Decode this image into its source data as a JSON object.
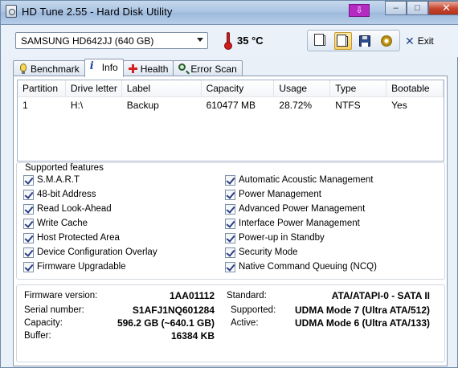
{
  "window": {
    "title": "HD Tune 2.55 - Hard Disk Utility",
    "badge": "⇩",
    "min": "–",
    "max": "□",
    "close": "✕"
  },
  "toolbar": {
    "drive": "SAMSUNG HD642JJ (640 GB)",
    "temperature": "35 °C",
    "exit": "Exit",
    "tools": [
      "copy-text-icon",
      "copy-screenshot-icon",
      "save-icon",
      "options-icon"
    ]
  },
  "tabs": [
    {
      "label": "Benchmark",
      "icon": "bulb-icon"
    },
    {
      "label": "Info",
      "icon": "info-icon",
      "active": true
    },
    {
      "label": "Health",
      "icon": "health-cross-icon"
    },
    {
      "label": "Error Scan",
      "icon": "magnifier-icon"
    }
  ],
  "partitions": {
    "headers": [
      "Partition",
      "Drive letter",
      "Label",
      "Capacity",
      "Usage",
      "Type",
      "Bootable"
    ],
    "rows": [
      [
        "1",
        "H:\\",
        "Backup",
        "610477 MB",
        "28.72%",
        "NTFS",
        "Yes"
      ]
    ]
  },
  "features": {
    "title": "Supported features",
    "left": [
      "S.M.A.R.T",
      "48-bit Address",
      "Read Look-Ahead",
      "Write Cache",
      "Host Protected Area",
      "Device Configuration Overlay",
      "Firmware Upgradable"
    ],
    "right": [
      "Automatic Acoustic Management",
      "Power Management",
      "Advanced Power Management",
      "Interface Power Management",
      "Power-up in Standby",
      "Security Mode",
      "Native Command Queuing (NCQ)"
    ]
  },
  "drive_info": {
    "firmware_label": "Firmware version:",
    "firmware": "1AA01112",
    "serial_label": "Serial number:",
    "serial": "S1AFJ1NQ601284",
    "capacity_label": "Capacity:",
    "capacity": "596.2 GB (~640.1 GB)",
    "buffer_label": "Buffer:",
    "buffer": "16384 KB",
    "standard_label": "Standard:",
    "standard": "ATA/ATAPI-0 - SATA II",
    "supported_label": "Supported:",
    "supported": "UDMA Mode 7 (Ultra ATA/512)",
    "active_label": "Active:",
    "active": "UDMA Mode 6 (Ultra ATA/133)"
  },
  "colors": {
    "accent": "#1a47a8",
    "temperature": "#d21b1b",
    "close": "#c5452d"
  }
}
